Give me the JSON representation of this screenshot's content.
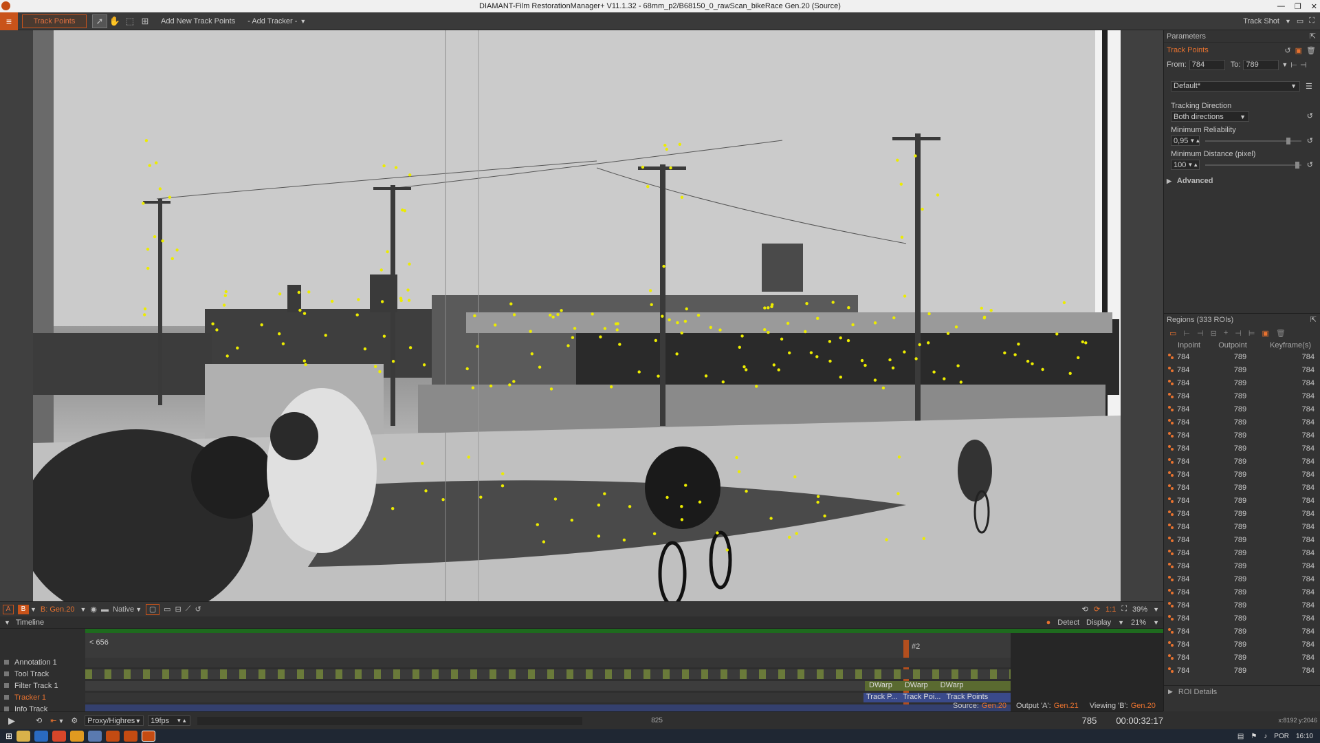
{
  "window": {
    "title": "DIAMANT-Film RestorationManager+ V11.1.32 - 68mm_p2/B68150_0_rawScan_bikeRace Gen.20 (Source)"
  },
  "toolbar": {
    "mode_label": "Track Points",
    "add_points_label": "Add New Track Points",
    "add_tracker_label": "- Add Tracker -",
    "track_shot_label": "Track Shot"
  },
  "parameters": {
    "title": "Parameters",
    "tool_title": "Track Points",
    "from_label": "From:",
    "from_value": "784",
    "to_label": "To:",
    "to_value": "789",
    "preset_value": "Default*",
    "tracking_direction_label": "Tracking Direction",
    "tracking_direction_value": "Both directions",
    "min_reliability_label": "Minimum Reliability",
    "min_reliability_value": "0,95",
    "min_reliability_fraction": 0.88,
    "min_distance_label": "Minimum Distance (pixel)",
    "min_distance_value": "100",
    "min_distance_fraction": 0.98,
    "advanced_label": "Advanced"
  },
  "regions": {
    "title": "Regions (333 ROIs)",
    "columns": [
      "Inpoint",
      "Outpoint",
      "Keyframe(s)"
    ],
    "rows": [
      [
        "784",
        "789",
        "784"
      ],
      [
        "784",
        "789",
        "784"
      ],
      [
        "784",
        "789",
        "784"
      ],
      [
        "784",
        "789",
        "784"
      ],
      [
        "784",
        "789",
        "784"
      ],
      [
        "784",
        "789",
        "784"
      ],
      [
        "784",
        "789",
        "784"
      ],
      [
        "784",
        "789",
        "784"
      ],
      [
        "784",
        "789",
        "784"
      ],
      [
        "784",
        "789",
        "784"
      ],
      [
        "784",
        "789",
        "784"
      ],
      [
        "784",
        "789",
        "784"
      ],
      [
        "784",
        "789",
        "784"
      ],
      [
        "784",
        "789",
        "784"
      ],
      [
        "784",
        "789",
        "784"
      ],
      [
        "784",
        "789",
        "784"
      ],
      [
        "784",
        "789",
        "784"
      ],
      [
        "784",
        "789",
        "784"
      ],
      [
        "784",
        "789",
        "784"
      ],
      [
        "784",
        "789",
        "784"
      ],
      [
        "784",
        "789",
        "784"
      ],
      [
        "784",
        "789",
        "784"
      ],
      [
        "784",
        "789",
        "784"
      ],
      [
        "784",
        "789",
        "784"
      ],
      [
        "784",
        "789",
        "784"
      ]
    ],
    "roi_details_label": "ROI Details"
  },
  "viewbar": {
    "view_a": "A",
    "view_b": "B",
    "generation": "B: Gen.20",
    "scale_mode": "Native",
    "zoom": "39%"
  },
  "timeline": {
    "title": "Timeline",
    "detect_label": "Detect",
    "display_label": "Display",
    "zoom": "21%",
    "range_start": "< 656",
    "range_end": "825",
    "marker_label": "#2",
    "tracks": [
      "Annotation 1",
      "Tool Track",
      "Filter Track 1",
      "Tracker 1",
      "Info Track"
    ],
    "clips_dwarp": [
      "DWarp",
      "DWarp",
      "DWarp"
    ],
    "clips_track": [
      "Track P...",
      "Track Poi...",
      "Track Points"
    ],
    "source_label": "Source:",
    "source_value": "Gen.20",
    "output_label": "Output 'A':",
    "output_value": "Gen.21",
    "viewing_label": "Viewing 'B':",
    "viewing_value": "Gen.20"
  },
  "transport": {
    "proxy_mode": "Proxy/Highres",
    "fps": "19fps",
    "mini_frame": "825",
    "current_frame": "785",
    "timecode": "00:00:32:17",
    "coords": "x:8192 y:2046"
  },
  "taskbar": {
    "language": "POR",
    "clock": "16:10"
  },
  "colors": {
    "accent": "#e8722f",
    "track_point": "#e6e600",
    "tracker_clip": "#3a4a8a",
    "filter_clip": "#6a7a3a"
  }
}
